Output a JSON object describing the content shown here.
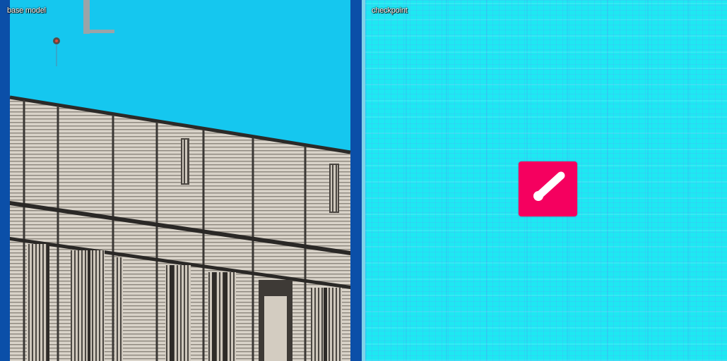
{
  "panels": {
    "left": {
      "caption": "base model"
    },
    "right": {
      "caption": "checkpoint"
    }
  },
  "colors": {
    "sky": "#15c7ef",
    "facade": "#d6d0c6",
    "frame": "#0b4fa8",
    "checkpoint_background": "#1ee8f2",
    "icon_fill": "#f5005f",
    "icon_glyph": "#ffffff"
  },
  "icons": {
    "checkpoint_icon": "pink-square-app-icon"
  }
}
